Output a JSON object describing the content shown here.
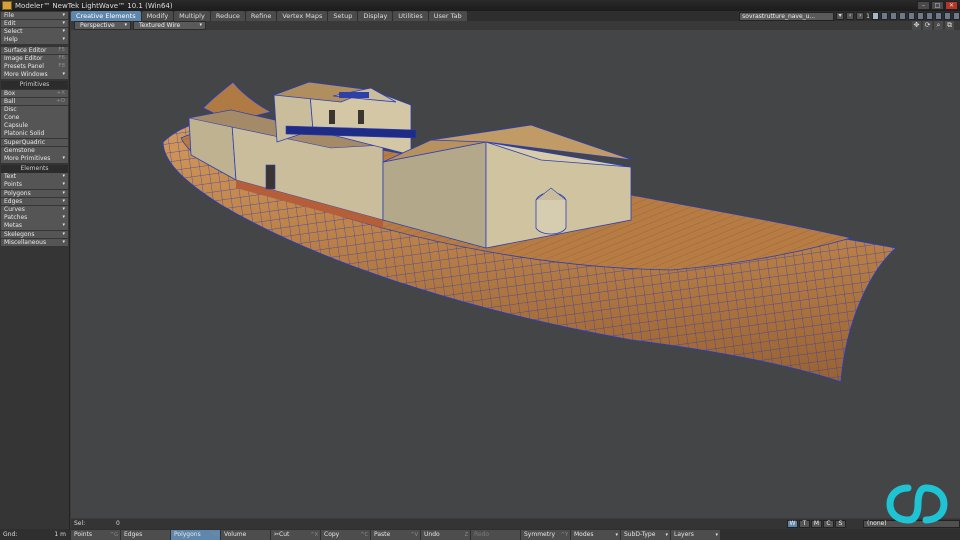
{
  "window": {
    "title": "Modeler™ NewTek LightWave™ 10.1 (Win64)"
  },
  "tabs": [
    {
      "label": "Creative Elements",
      "active": true
    },
    {
      "label": "Modify"
    },
    {
      "label": "Multiply"
    },
    {
      "label": "Reduce"
    },
    {
      "label": "Refine"
    },
    {
      "label": "Vertex Maps"
    },
    {
      "label": "Setup"
    },
    {
      "label": "Display"
    },
    {
      "label": "Utilities"
    },
    {
      "label": "User Tab"
    }
  ],
  "object_select": "sovrastrutture_nave_u...",
  "layer_number": "1",
  "menu": {
    "top": [
      {
        "label": "File",
        "arrow": "▾"
      },
      {
        "label": "Edit",
        "arrow": "▾"
      },
      {
        "label": "Select",
        "arrow": "▾"
      },
      {
        "label": "Help",
        "arrow": "▾"
      }
    ],
    "editors": [
      {
        "label": "Surface Editor",
        "key": "F5"
      },
      {
        "label": "Image Editor",
        "key": "F6"
      },
      {
        "label": "Presets Panel",
        "key": "F8"
      },
      {
        "label": "More Windows",
        "arrow": "▾"
      }
    ],
    "primitives_header": "Primitives",
    "primitives": [
      {
        "label": "Box",
        "key": "+X"
      },
      {
        "label": "Ball",
        "key": "+O"
      },
      {
        "label": "Disc"
      },
      {
        "label": "Cone"
      },
      {
        "label": "Capsule"
      },
      {
        "label": "Platonic Solid"
      },
      {
        "label": "SuperQuadric"
      },
      {
        "label": "Gemstone"
      },
      {
        "label": "More Primitives",
        "arrow": "▾"
      }
    ],
    "elements_header": "Elements",
    "elements": [
      {
        "label": "Text",
        "arrow": "▾"
      },
      {
        "label": "Points",
        "arrow": "▾"
      },
      {
        "label": "Polygons",
        "arrow": "▾"
      },
      {
        "label": "Edges",
        "arrow": "▾"
      },
      {
        "label": "Curves",
        "arrow": "▾"
      },
      {
        "label": "Patches",
        "arrow": "▾"
      },
      {
        "label": "Metas",
        "arrow": "▾"
      },
      {
        "label": "Skelegons",
        "arrow": "▾"
      },
      {
        "label": "Miscellaneous",
        "arrow": "▾"
      }
    ]
  },
  "viewport": {
    "view_type": "Perspective",
    "render_style": "Textured Wire"
  },
  "status": {
    "sel_label": "Sel:",
    "sel_value": "0",
    "grid_label": "Gnd:",
    "grid_value": "1 m",
    "view_buttons": [
      "W",
      "T",
      "M",
      "C",
      "S"
    ],
    "vmap": "(none)"
  },
  "modebar": [
    {
      "label": "Points",
      "key": "^G"
    },
    {
      "label": "Edges",
      "key": ""
    },
    {
      "label": "Polygons",
      "key": "^H",
      "active": true
    },
    {
      "label": "Volume",
      "key": ""
    },
    {
      "label": "Cut",
      "key": "^X"
    },
    {
      "label": "Copy",
      "key": "^C"
    },
    {
      "label": "Paste",
      "key": "^V"
    },
    {
      "label": "Undo",
      "key": "Z"
    },
    {
      "label": "Redo",
      "key": "",
      "disabled": true
    },
    {
      "label": "Symmetry",
      "key": "^Y"
    },
    {
      "label": "Modes",
      "arrow": "▾"
    },
    {
      "label": "SubD-Type",
      "arrow": "▾"
    },
    {
      "label": "Layers",
      "arrow": "▾"
    }
  ],
  "colors": {
    "accent": "#5f86ad",
    "hull_wood": "#c98a4e",
    "wire": "#2a3fb5",
    "wall": "#c9bd9c",
    "roof": "#b8925e",
    "logo": "#1fc4d4"
  }
}
